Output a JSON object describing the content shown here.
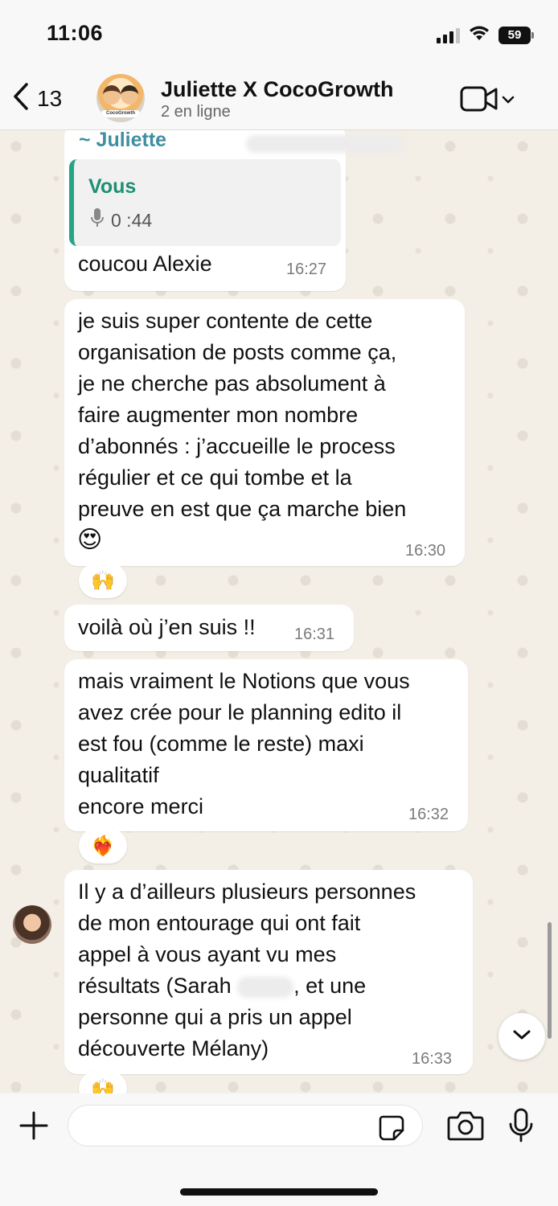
{
  "status_bar": {
    "time": "11:06",
    "battery": "59"
  },
  "header": {
    "back_count": "13",
    "title": "Juliette X CocoGrowth",
    "subtitle": "2 en ligne",
    "avatar_tag": "CocoGrowth"
  },
  "messages": [
    {
      "sender": "~ Juliette",
      "quote": {
        "author": "Vous",
        "audio_duration": "0 :44"
      },
      "text": "coucou Alexie",
      "time": "16:27"
    },
    {
      "text": "je suis super contente de cette\norganisation de posts comme ça,\nje ne cherche pas absolument à\nfaire augmenter mon nombre\nd’abonnés : j’accueille le process\nrégulier et ce qui tombe et la\npreuve en est que ça marche bien",
      "emoji": "😍",
      "time": "16:30",
      "reaction": "🙌"
    },
    {
      "text": "voilà où j’en suis !!",
      "time": "16:31"
    },
    {
      "text": "mais vraiment le Notions que vous\navez crée pour le  planning edito il\nest fou (comme le reste) maxi\nqualitatif\nencore merci",
      "time": "16:32",
      "reaction": "❤️‍🔥"
    },
    {
      "text_before_name": "Il y a d’ailleurs plusieurs personnes\nde mon entourage qui ont fait\nappel à vous ayant vu mes\nrésultats (Sarah ",
      "text_after_name": ", et une\npersonne qui a pris un appel\ndécouverte Mélany)",
      "time": "16:33",
      "reaction": "🙌"
    }
  ],
  "input": {
    "placeholder": ""
  },
  "colors": {
    "chat_background": "#f3eee6",
    "sender_name": "#3f8fa0",
    "quote_accent": "#25a586",
    "bubble": "#ffffff"
  },
  "icons": [
    "signal-icon",
    "wifi-icon",
    "battery-icon",
    "back-chevron-icon",
    "video-call-icon",
    "chevron-down-icon",
    "mic-small-icon",
    "plus-icon",
    "sticker-icon",
    "camera-icon",
    "mic-icon"
  ]
}
